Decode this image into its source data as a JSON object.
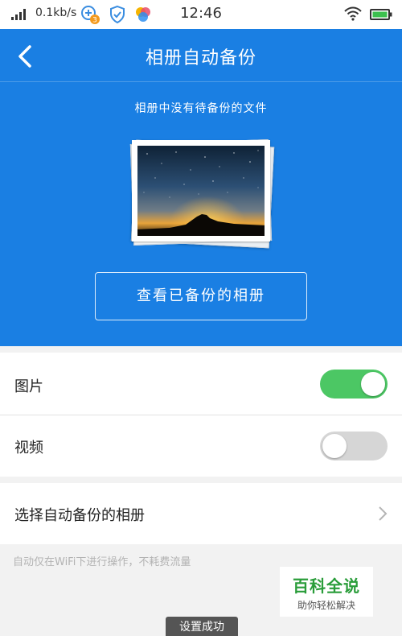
{
  "status_bar": {
    "network_speed": "0.1kb/s",
    "badge_count": "3",
    "time": "12:46"
  },
  "header": {
    "title": "相册自动备份",
    "status_text": "相册中没有待备份的文件",
    "view_button_label": "查看已备份的相册"
  },
  "settings": {
    "photos": {
      "label": "图片",
      "enabled": true
    },
    "videos": {
      "label": "视频",
      "enabled": false
    },
    "album_label": "选择自动备份的相册"
  },
  "hint_text": "自动仅在WiFi下进行操作，不耗费流量",
  "watermark": {
    "title": "百科全说",
    "subtitle": "助你轻松解决"
  },
  "toast": "设置成功",
  "colors": {
    "primary": "#1a7fe3",
    "toggle_on": "#4cc764",
    "toggle_off": "#d6d6d6",
    "watermark_green": "#2a9d3a"
  },
  "icons": [
    "signal-icon",
    "app-notification-icon",
    "shield-icon",
    "colorful-app-icon",
    "wifi-icon",
    "battery-icon",
    "back-arrow-icon",
    "chevron-right-icon"
  ]
}
